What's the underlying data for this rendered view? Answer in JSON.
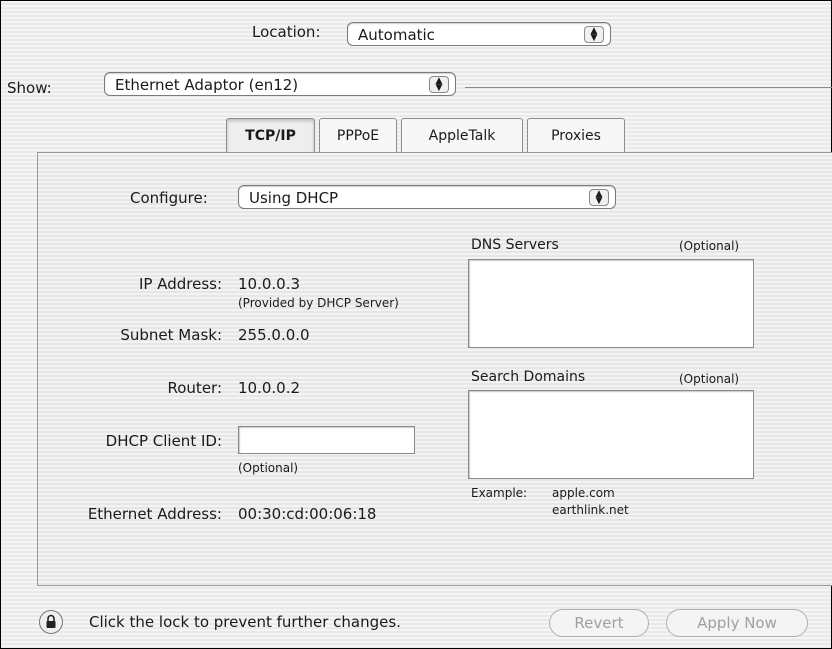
{
  "location": {
    "label": "Location:",
    "value": "Automatic"
  },
  "show": {
    "label": "Show:",
    "value": "Ethernet Adaptor (en12)"
  },
  "tabs": [
    {
      "label": "TCP/IP",
      "active": true
    },
    {
      "label": "PPPoE",
      "active": false
    },
    {
      "label": "AppleTalk",
      "active": false
    },
    {
      "label": "Proxies",
      "active": false
    }
  ],
  "configure": {
    "label": "Configure:",
    "value": "Using DHCP"
  },
  "ip_address": {
    "label": "IP Address:",
    "value": "10.0.0.3",
    "note": "(Provided by DHCP Server)"
  },
  "subnet_mask": {
    "label": "Subnet Mask:",
    "value": "255.0.0.0"
  },
  "router": {
    "label": "Router:",
    "value": "10.0.0.2"
  },
  "dhcp_client_id": {
    "label": "DHCP Client ID:",
    "value": "",
    "note": "(Optional)"
  },
  "ethernet_address": {
    "label": "Ethernet Address:",
    "value": "00:30:cd:00:06:18"
  },
  "dns_servers": {
    "label": "DNS Servers",
    "optional": "(Optional)",
    "value": ""
  },
  "search_domains": {
    "label": "Search Domains",
    "optional": "(Optional)",
    "value": ""
  },
  "example": {
    "label": "Example:",
    "line1": "apple.com",
    "line2": "earthlink.net"
  },
  "lock": {
    "text": "Click the lock to prevent further changes.",
    "icon": "lock-icon"
  },
  "buttons": {
    "revert": "Revert",
    "apply": "Apply Now"
  }
}
